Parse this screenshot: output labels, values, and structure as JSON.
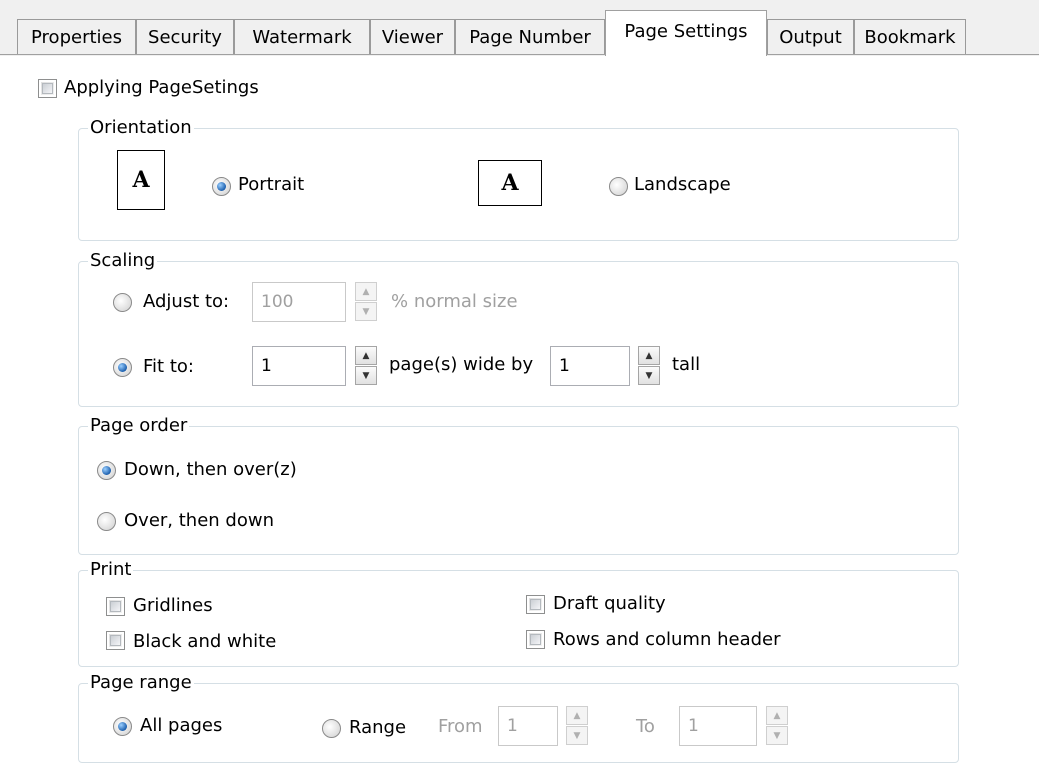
{
  "tabs": [
    {
      "label": "Properties"
    },
    {
      "label": "Security"
    },
    {
      "label": "Watermark"
    },
    {
      "label": "Viewer"
    },
    {
      "label": "Page Number"
    },
    {
      "label": "Page Settings",
      "active": true
    },
    {
      "label": "Output"
    },
    {
      "label": "Bookmark"
    }
  ],
  "apply": {
    "label": "Applying PageSetings",
    "checked": false
  },
  "orientation": {
    "title": "Orientation",
    "icon_glyph": "A",
    "portrait_label": "Portrait",
    "landscape_label": "Landscape",
    "selected": "portrait"
  },
  "scaling": {
    "title": "Scaling",
    "adjust_label": "Adjust to:",
    "adjust_value": "100",
    "adjust_suffix": "% normal size",
    "fit_label": "Fit to:",
    "fit_wide_value": "1",
    "fit_middle": "page(s) wide by",
    "fit_tall_value": "1",
    "fit_suffix": "tall",
    "selected": "fit"
  },
  "page_order": {
    "title": "Page order",
    "down_label": "Down, then over(z)",
    "over_label": "Over, then down",
    "selected": "down"
  },
  "print": {
    "title": "Print",
    "gridlines": "Gridlines",
    "black_white": "Black and white",
    "draft": "Draft quality",
    "rows_cols": "Rows and column header"
  },
  "page_range": {
    "title": "Page range",
    "all_label": "All pages",
    "range_label": "Range",
    "from_label": "From",
    "from_value": "1",
    "to_label": "To",
    "to_value": "1",
    "selected": "all"
  },
  "colors": {
    "group_border": "#d5dfe5",
    "tab_bg": "#f0f0f0",
    "disabled_text": "#a0a0a0"
  }
}
